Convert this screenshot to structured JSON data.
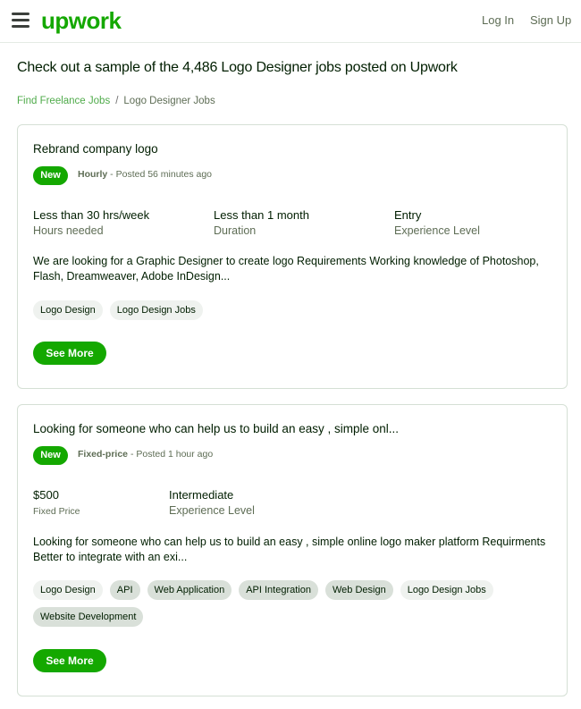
{
  "theme": {
    "brand_color": "#14a800",
    "link_color": "#4fab4a"
  },
  "header": {
    "logo_text": "upwork",
    "login_label": "Log In",
    "signup_label": "Sign Up"
  },
  "page_title": "Check out a sample of the 4,486 Logo Designer jobs posted on Upwork",
  "breadcrumb": {
    "link_label": "Find Freelance Jobs",
    "separator": "/",
    "current_label": "Logo Designer Jobs"
  },
  "jobs": [
    {
      "title": "Rebrand company logo",
      "badge": "New",
      "type": "Hourly",
      "posted": " - Posted 56 minutes ago",
      "stats": [
        {
          "value": "Less than 30 hrs/week",
          "label": "Hours needed"
        },
        {
          "value": "Less than 1 month",
          "label": "Duration"
        },
        {
          "value": "Entry",
          "label": "Experience Level"
        }
      ],
      "description": "We are looking for a Graphic Designer to create logo Requirements Working knowledge of Photoshop, Flash, Dreamweaver, Adobe InDesign...",
      "tags": [
        {
          "label": "Logo Design",
          "highlighted": false
        },
        {
          "label": "Logo Design Jobs",
          "highlighted": false
        }
      ],
      "button_label": "See More"
    },
    {
      "title": "Looking for someone who can help us to build an easy , simple onl...",
      "badge": "New",
      "type": "Fixed-price",
      "posted": " - Posted 1 hour ago",
      "stats": [
        {
          "value": "$500",
          "label": "Fixed Price"
        },
        {
          "value": "Intermediate",
          "label": "Experience Level"
        }
      ],
      "description": "Looking for someone who can help us to build an easy , simple online logo maker platform Requirments Better to integrate with an exi...",
      "tags": [
        {
          "label": "Logo Design",
          "highlighted": false
        },
        {
          "label": "API",
          "highlighted": true
        },
        {
          "label": "Web Application",
          "highlighted": true
        },
        {
          "label": "API Integration",
          "highlighted": true
        },
        {
          "label": "Web Design",
          "highlighted": true
        },
        {
          "label": "Logo Design Jobs",
          "highlighted": false
        },
        {
          "label": "Website Development",
          "highlighted": true
        }
      ],
      "button_label": "See More"
    }
  ]
}
